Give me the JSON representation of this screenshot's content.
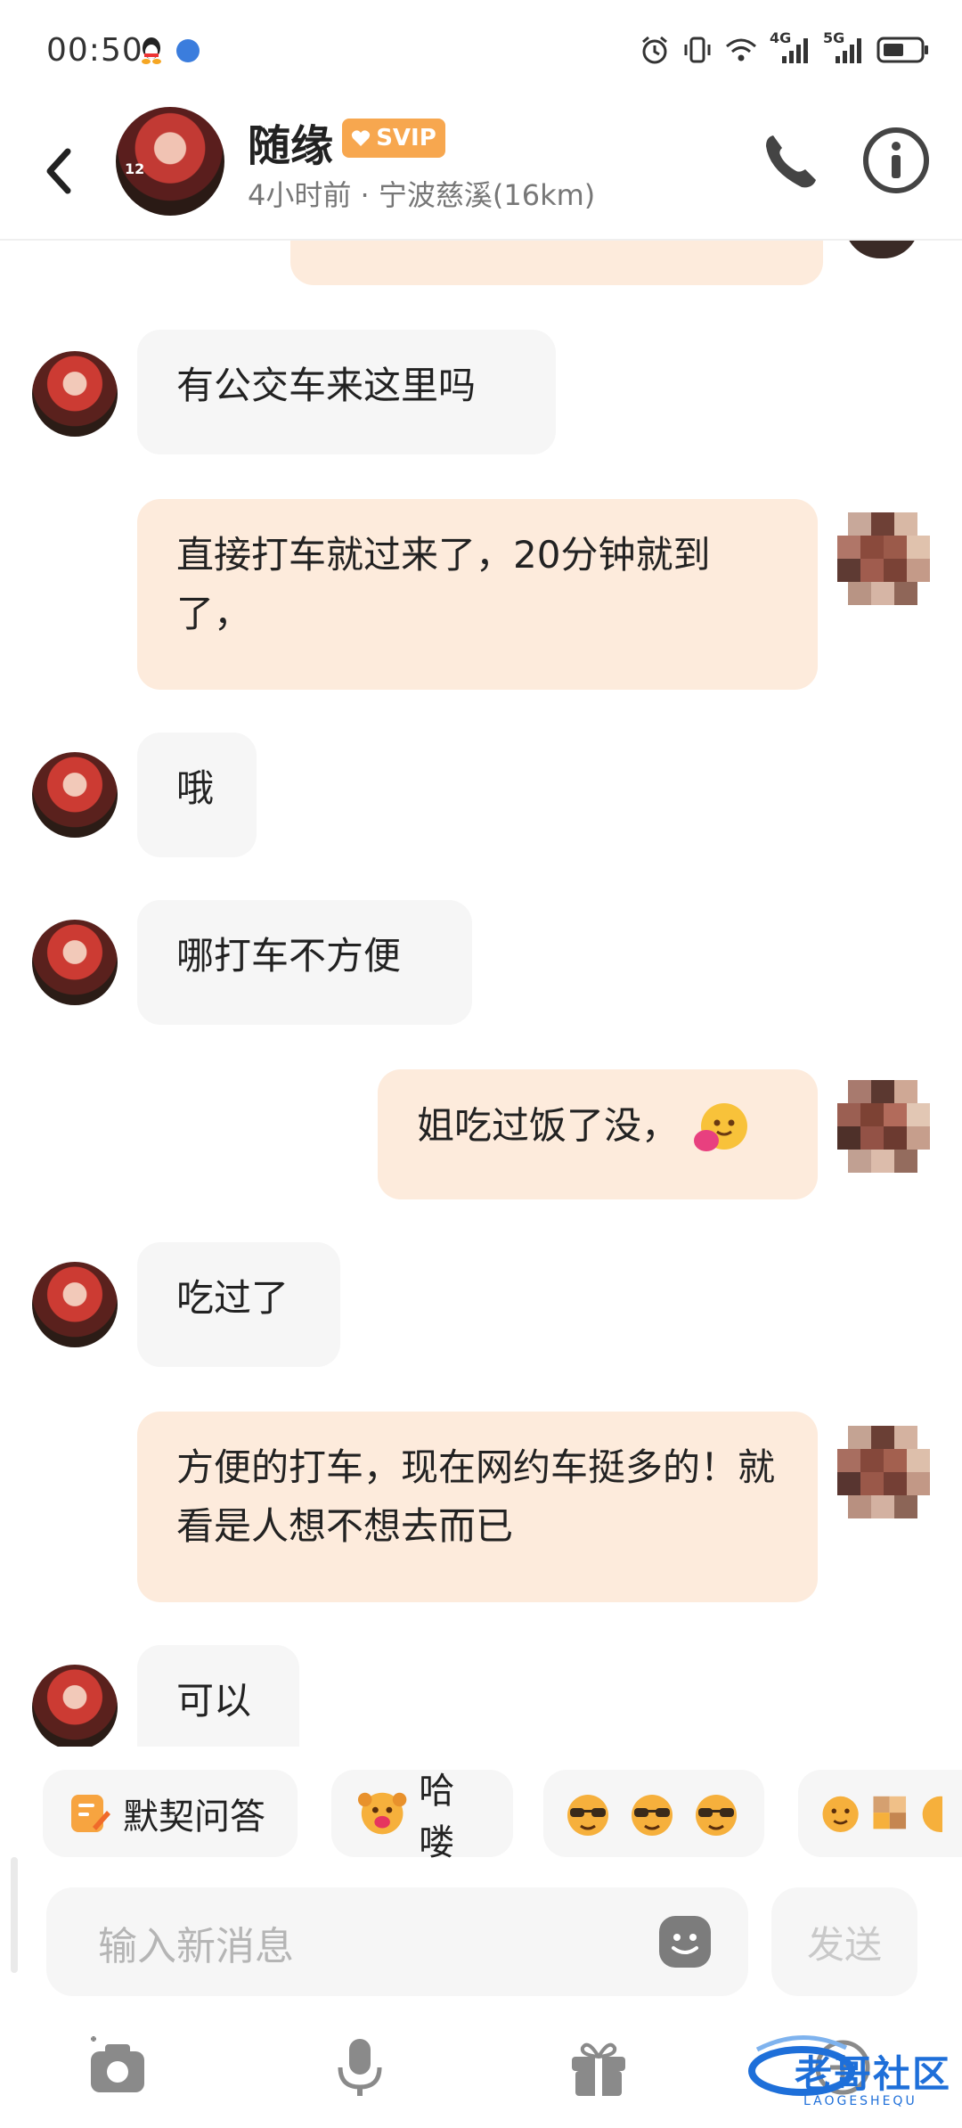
{
  "status_bar": {
    "time": "00:50",
    "network_1": "4G",
    "network_2": "5G"
  },
  "header": {
    "back_icon": "chevron-left-icon",
    "name": "随缘",
    "badge": "SVIP",
    "meta": "4小时前 · 宁波慈溪(16km)",
    "avatar_age_text": "12",
    "call_icon": "phone-icon",
    "info_icon": "info-icon"
  },
  "messages": [
    {
      "side": "out",
      "text": ""
    },
    {
      "side": "in",
      "text": "有公交车来这里吗"
    },
    {
      "side": "out",
      "text": "直接打车就过来了，20分钟就到了，"
    },
    {
      "side": "in",
      "text": "哦"
    },
    {
      "side": "in",
      "text": "哪打车不方便"
    },
    {
      "side": "out",
      "text": "姐吃过饭了没，"
    },
    {
      "side": "in",
      "text": "吃过了"
    },
    {
      "side": "out",
      "text": "方便的打车，现在网约车挺多的！就看是人想不想去而已"
    },
    {
      "side": "in",
      "text": "可以"
    }
  ],
  "quick_replies": [
    {
      "label": "默契问答",
      "icon": "edit-note-icon"
    },
    {
      "label": "哈喽",
      "icon": "hello-emoji-icon"
    },
    {
      "label": "",
      "icon": "sunglasses-emoji-icon"
    },
    {
      "label": "",
      "icon": "emoji-icon"
    }
  ],
  "input": {
    "placeholder": "输入新消息",
    "send_label": "发送"
  },
  "toolbar": {
    "icons": [
      "camera-icon",
      "microphone-icon",
      "gift-icon",
      "plus-icon"
    ]
  },
  "watermark": {
    "text": "老哥社区",
    "subtext": "LAOGESHEQU"
  },
  "colors": {
    "out_bubble": "#fdebdc",
    "in_bubble": "#f6f6f6",
    "svip": "#f7a74f",
    "accent_blue": "#1e6fd9"
  }
}
